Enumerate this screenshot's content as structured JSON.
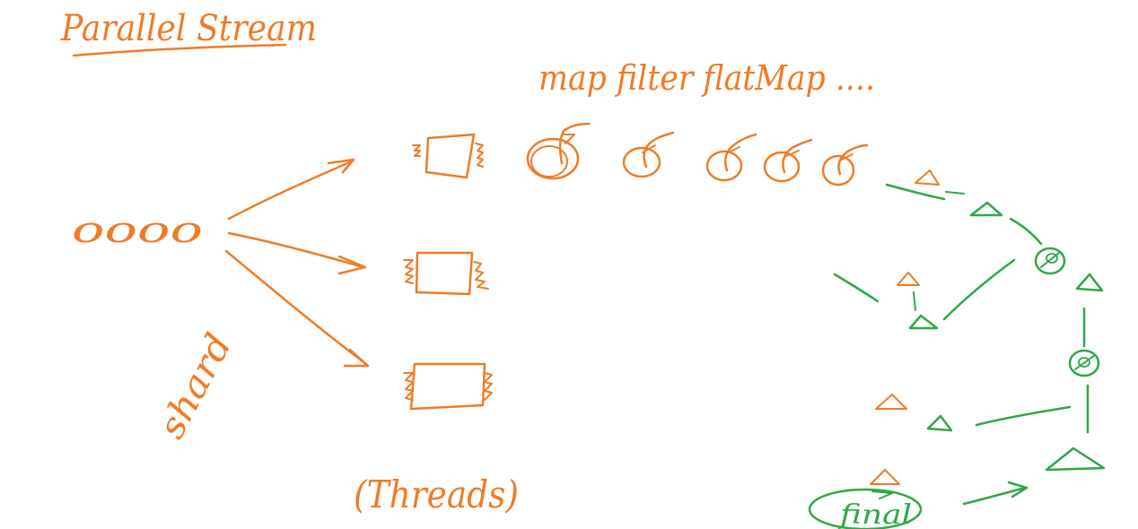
{
  "colors": {
    "orange_ink": "#f07b25",
    "green_ink": "#2ea847",
    "background": "#ffffff"
  },
  "labels": {
    "title": "Parallel Stream",
    "ops": "map filter flatMap ....",
    "elements": "oooo",
    "shard": "shard",
    "threads": "(Threads)",
    "final": "final"
  }
}
